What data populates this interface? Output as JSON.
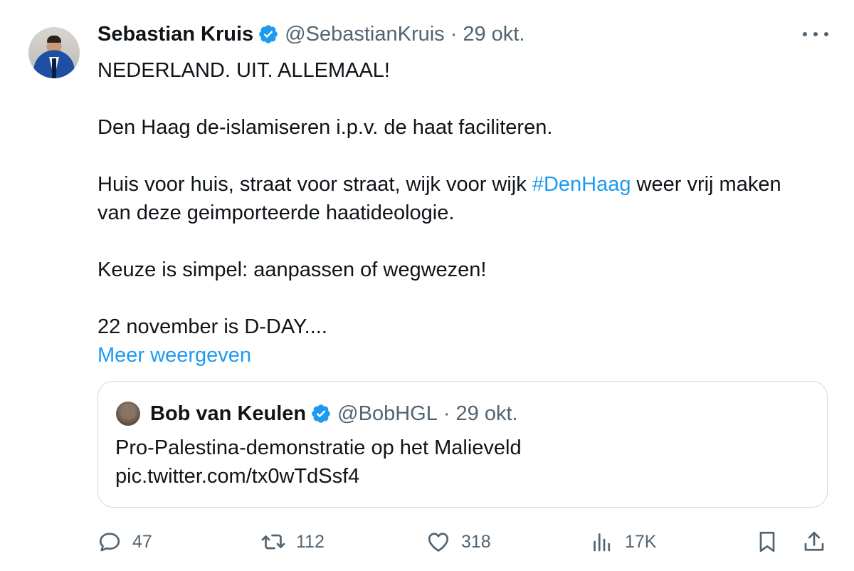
{
  "tweet": {
    "author_name": "Sebastian Kruis",
    "handle": "@SebastianKruis",
    "separator": "·",
    "date": "29 okt.",
    "lines": [
      "NEDERLAND. UIT. ALLEMAAL!",
      "Den Haag de-islamiseren i.p.v. de haat faciliteren.",
      "Huis voor huis, straat voor straat, wijk voor wijk ",
      "#DenHaag",
      " weer vrij maken",
      "van deze geimporteerde haatideologie.",
      "Keuze is simpel: aanpassen of wegwezen!",
      "22 november is D-DAY...."
    ],
    "show_more_label": "Meer weergeven"
  },
  "quote": {
    "author_name": "Bob van Keulen",
    "handle": "@BobHGL",
    "separator": "·",
    "date": "29 okt.",
    "text": "Pro-Palestina-demonstratie op het Malieveld",
    "link": "pic.twitter.com/tx0wTdSsf4"
  },
  "actions": {
    "replies": "47",
    "retweets": "112",
    "likes": "318",
    "views": "17K"
  },
  "icons": {
    "verified": "verified-badge-icon",
    "more": "more-options-icon",
    "reply": "reply-icon",
    "retweet": "retweet-icon",
    "like": "heart-icon",
    "views": "views-icon",
    "bookmark": "bookmark-icon",
    "share": "share-icon"
  },
  "colors": {
    "accent": "#1d9bf0",
    "secondary_text": "#536471",
    "text": "#0f1419",
    "border": "#cfd9de"
  }
}
